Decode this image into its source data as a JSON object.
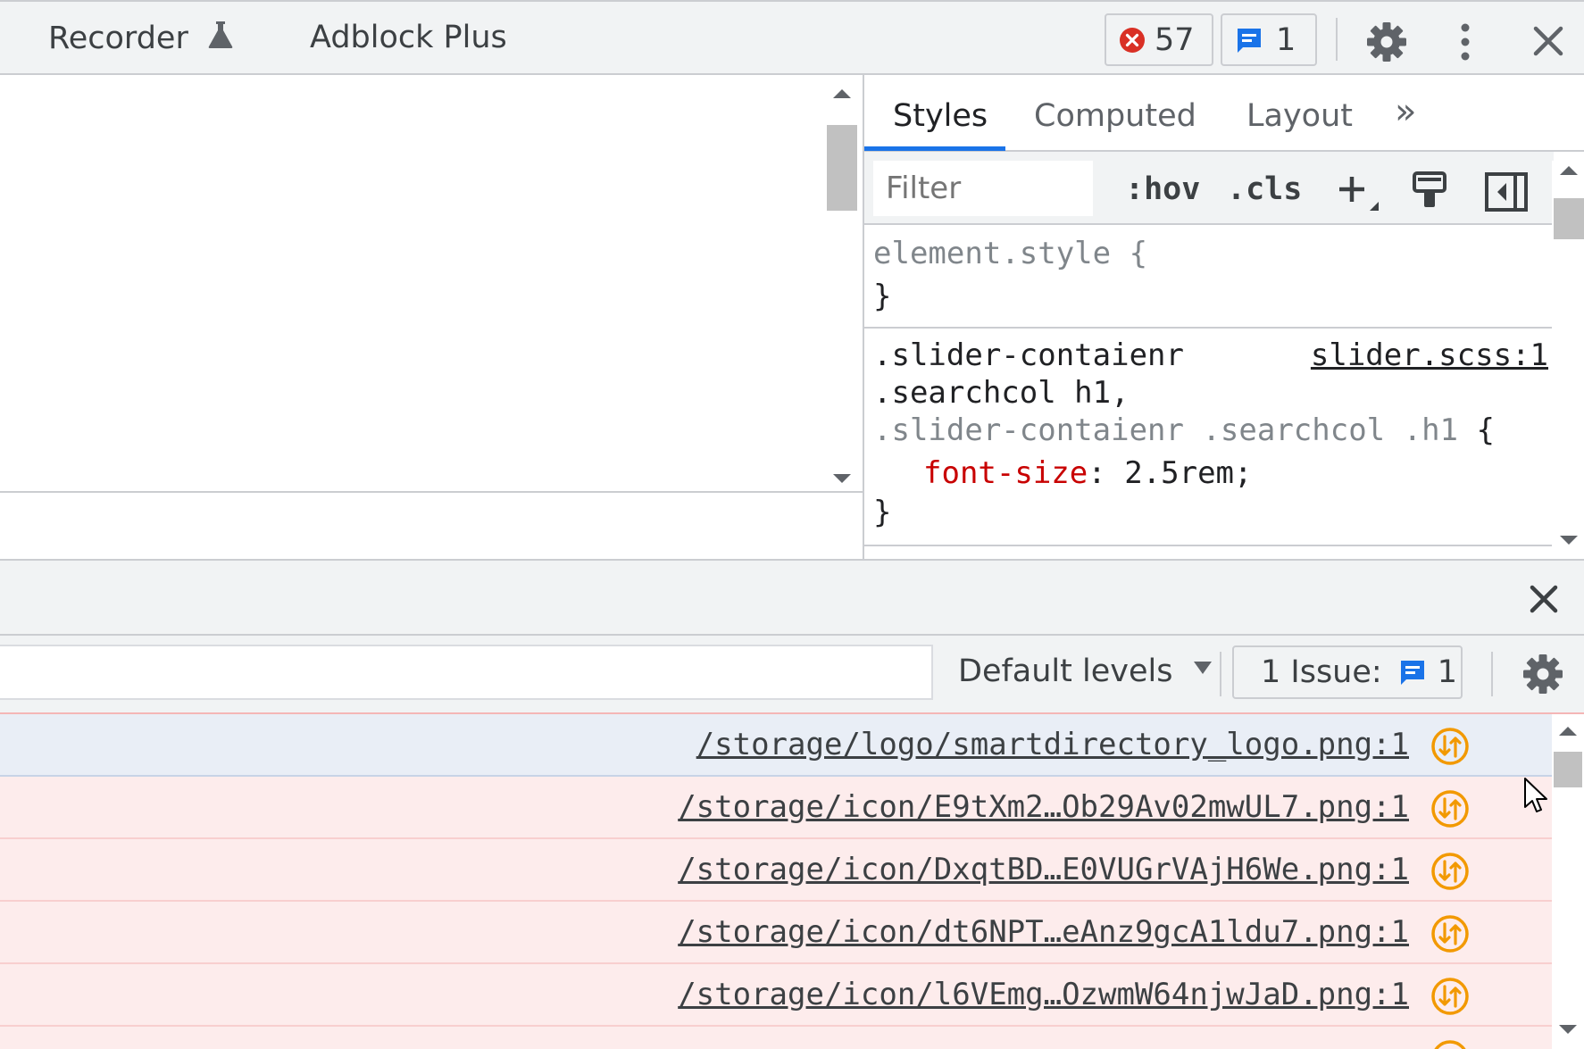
{
  "top_tabs": [
    {
      "label": "Recorder"
    },
    {
      "label": "Adblock Plus"
    }
  ],
  "toolbar": {
    "error_count": "57",
    "message_count": "1"
  },
  "styles_panel": {
    "tabs": [
      {
        "label": "Styles"
      },
      {
        "label": "Computed"
      },
      {
        "label": "Layout"
      }
    ],
    "more_tabs_glyph": "»",
    "filter_placeholder": "Filter",
    "hov_label": ":hov",
    "cls_label": ".cls",
    "rules": {
      "element_style": {
        "selector": "element.style {",
        "close": "}"
      },
      "rule1": {
        "selector_line1": ".slider-contaienr",
        "selector_line2": ".searchcol h1,",
        "selector_line3": ".slider-contaienr .searchcol .h1",
        "open_brace": "{",
        "source": "slider.scss:1",
        "property": "font-size",
        "colon": ":",
        "value": "2.5rem;",
        "close": "}"
      }
    }
  },
  "console": {
    "levels_label": "Default levels",
    "issues_label": "1 Issue:",
    "issues_count": "1",
    "messages": [
      {
        "source": "/storage/logo/smartdirectory_logo.png:1"
      },
      {
        "source": "/storage/icon/E9tXm2…Ob29Av02mwUL7.png:1"
      },
      {
        "source": "/storage/icon/DxqtBD…E0VUGrVAjH6We.png:1"
      },
      {
        "source": "/storage/icon/dt6NPT…eAnz9gcA1ldu7.png:1"
      },
      {
        "source": "/storage/icon/l6VEmg…OzwmW64njwJaD.png:1"
      }
    ]
  },
  "colors": {
    "accent_blue": "#1a73e8",
    "error_red": "#d93025",
    "warning_orange": "#f29900",
    "property_red": "#c80000"
  }
}
